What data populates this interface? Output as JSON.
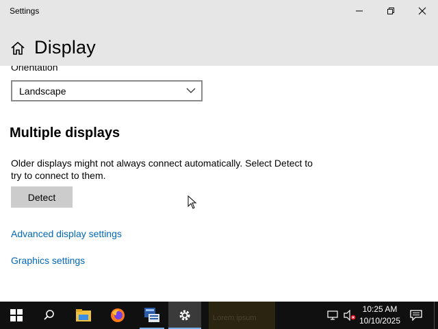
{
  "window": {
    "title": "Settings",
    "minimize_icon": "minimize-icon",
    "maximize_icon": "restore-icon",
    "close_icon": "close-icon"
  },
  "header": {
    "home_icon": "home-icon",
    "title": "Display"
  },
  "orientation": {
    "label": "Orientation",
    "selected": "Landscape"
  },
  "multiple_displays": {
    "title": "Multiple displays",
    "description": "Older displays might not always connect automatically. Select Detect to try to connect to them.",
    "detect_label": "Detect"
  },
  "links": {
    "advanced": "Advanced display settings",
    "graphics": "Graphics settings"
  },
  "taskbar": {
    "apps": [
      "start-icon",
      "search-icon",
      "file-explorer-icon",
      "firefox-icon",
      "terminal-icon",
      "settings-icon"
    ],
    "ghost_label": "Lorem ipsum",
    "time": "10:25 AM",
    "date": "10/10/2025",
    "tray": [
      "network-icon",
      "volume-muted-icon",
      "notification-icon"
    ]
  },
  "colors": {
    "chrome": "#e6e6e6",
    "link": "#0067b8",
    "button": "#cccccc",
    "taskbar": "#101010",
    "accent": "#7aaee8"
  }
}
